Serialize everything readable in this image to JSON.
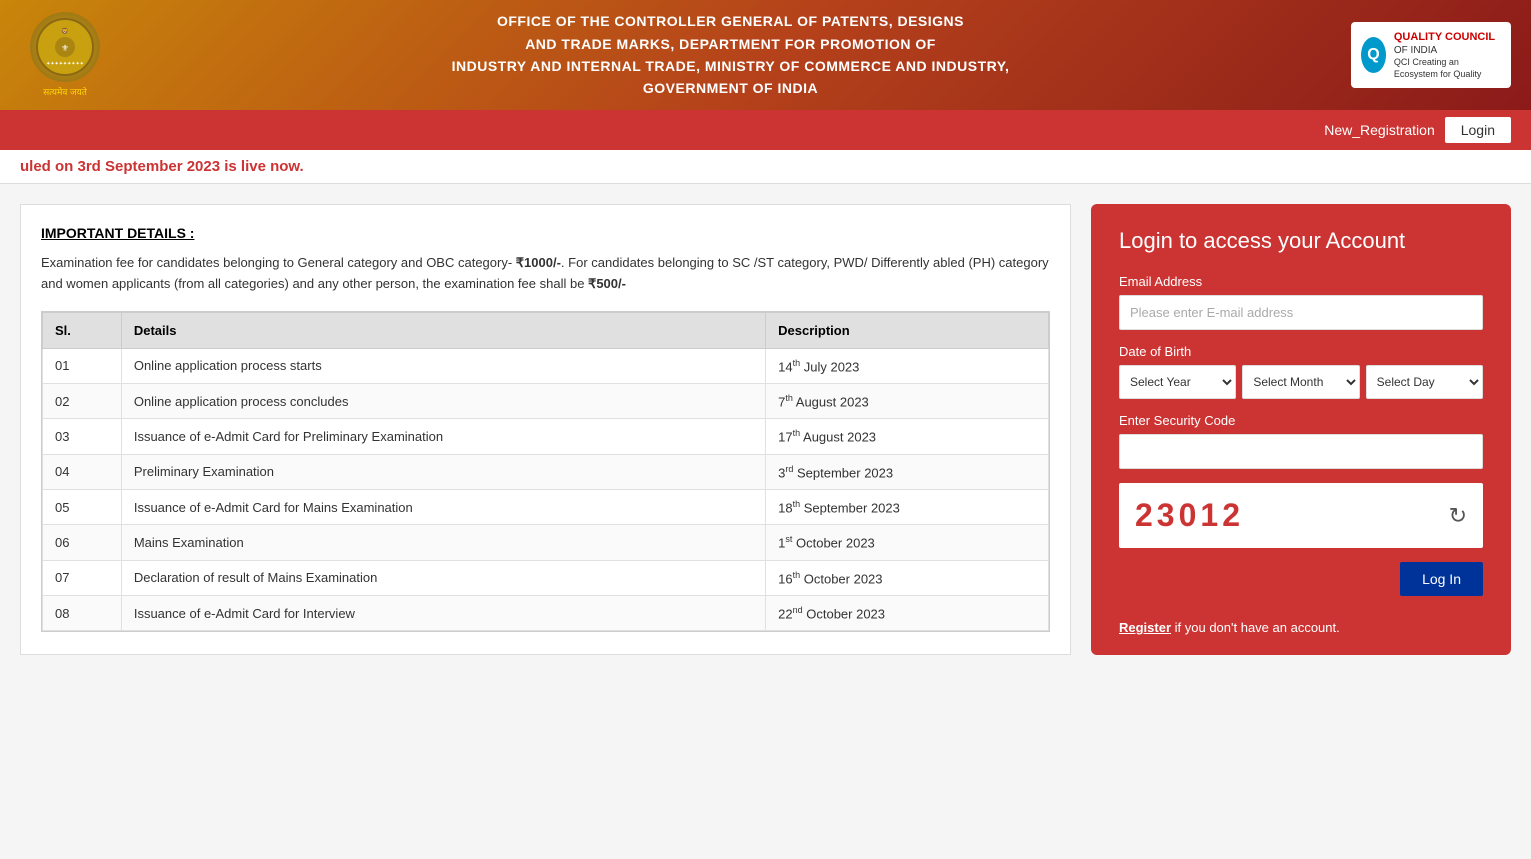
{
  "header": {
    "title_line1": "OFFICE OF THE CONTROLLER GENERAL OF PATENTS, DESIGNS",
    "title_line2": "AND TRADE MARKS, DEPARTMENT FOR PROMOTION OF",
    "title_line3": "INDUSTRY AND INTERNAL TRADE, MINISTRY OF COMMERCE AND INDUSTRY,",
    "title_line4": "GOVERNMENT OF INDIA",
    "satyamev_label": "सत्यमेव जयते",
    "qci_label": "QUALITY COUNCIL",
    "qci_sub1": "OF INDIA",
    "qci_sub2": "Creating an Ecosystem for Quality",
    "qci_abbr": "QCI"
  },
  "navbar": {
    "new_registration": "New_Registration",
    "login": "Login"
  },
  "ticker": {
    "text": "uled on 3rd September 2023 is live now."
  },
  "left": {
    "important_title": "IMPORTANT DETAILS :",
    "fee_text": "Examination fee for candidates belonging to General category and OBC category- ₹1000/-. For candidates belonging to SC /ST category, PWD/ Differently abled (PH) category and women applicants (from all categories) and any other person, the examination fee shall be ₹500/-",
    "table": {
      "headers": [
        "Sl.",
        "Details",
        "Description"
      ],
      "rows": [
        {
          "sl": "01",
          "details": "Online application process starts",
          "desc": "14",
          "desc_sup": "th",
          "desc_rest": " July 2023"
        },
        {
          "sl": "02",
          "details": "Online application process concludes",
          "desc": "7",
          "desc_sup": "th",
          "desc_rest": " August 2023"
        },
        {
          "sl": "03",
          "details": "Issuance of e-Admit Card for Preliminary Examination",
          "desc": "17",
          "desc_sup": "th",
          "desc_rest": " August 2023"
        },
        {
          "sl": "04",
          "details": "Preliminary Examination",
          "desc": "3",
          "desc_sup": "rd",
          "desc_rest": " September 2023"
        },
        {
          "sl": "05",
          "details": "Issuance of e-Admit Card for Mains Examination",
          "desc": "18",
          "desc_sup": "th",
          "desc_rest": " September 2023"
        },
        {
          "sl": "06",
          "details": "Mains Examination",
          "desc": "1",
          "desc_sup": "st",
          "desc_rest": " October 2023"
        },
        {
          "sl": "07",
          "details": "Declaration of result of Mains Examination",
          "desc": "16",
          "desc_sup": "th",
          "desc_rest": " October 2023"
        },
        {
          "sl": "08",
          "details": "Issuance of e-Admit Card for Interview",
          "desc": "22",
          "desc_sup": "nd",
          "desc_rest": " October 2023"
        }
      ]
    }
  },
  "login_panel": {
    "title": "Login to access your Account",
    "email_label": "Email Address",
    "email_placeholder": "Please enter E-mail address",
    "dob_label": "Date of Birth",
    "select_year": "Select Year",
    "select_month": "Select Month",
    "select_day": "Select Day",
    "security_label": "Enter Security Code",
    "security_placeholder": "",
    "captcha_code": "23012",
    "login_btn": "Log In",
    "register_text": "Register",
    "register_suffix": " if you don't have an account."
  }
}
